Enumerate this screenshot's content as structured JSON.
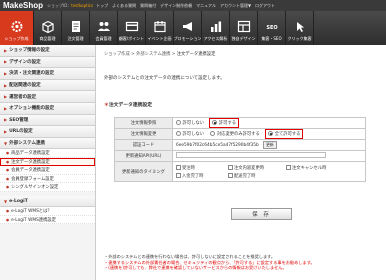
{
  "topbar": {
    "logo": "MakeShop",
    "shop_prefix": "ショップID：",
    "shop_id": "testkoptics",
    "nav": [
      "トップ",
      "よくある質問",
      "質問箱付",
      "デザイン制作依頼",
      "マニュアル",
      "アカウント管理▼",
      "ログアウト"
    ]
  },
  "toolbar": [
    {
      "label": "ショップ作成",
      "icon": "gear-icon",
      "active": true
    },
    {
      "label": "商品管理",
      "icon": "box-icon"
    },
    {
      "label": "注文管理",
      "icon": "receipt-icon"
    },
    {
      "label": "会員管理",
      "icon": "users-icon"
    },
    {
      "label": "顧客/ポイント",
      "icon": "card-icon"
    },
    {
      "label": "イベント企画",
      "icon": "calendar-icon"
    },
    {
      "label": "プロモーション",
      "icon": "megaphone-icon"
    },
    {
      "label": "アクセス解析",
      "icon": "chart-icon"
    },
    {
      "label": "独自デザイン",
      "icon": "design-icon"
    },
    {
      "label": "集客・SEO",
      "icon": "seo-icon"
    },
    {
      "label": "クリック集客",
      "icon": "click-icon"
    }
  ],
  "sidebar": {
    "sections": [
      "ショップ情報の設定",
      "デザインの設定",
      "決済・注文関連の設定",
      "配送関連の設定",
      "運営者の設定",
      "オプション機能の設定",
      "SEO管理",
      "URLの設定"
    ],
    "open_section": "外部システム連携",
    "sub_items": [
      "商品データ連携設定",
      "注文データ連携設定",
      "会員データ連携設定",
      "会員登録フォーム設定",
      "シングルサインオン設定"
    ],
    "selected_index": 1,
    "section2": "e-LogiT",
    "sub2": [
      "e-LogiT WMSとは？",
      "e-LogiT WMS連携設定"
    ]
  },
  "main": {
    "breadcrumb": [
      "ショップ作成",
      "外部システム連携",
      "注文データ連携設定"
    ],
    "intro": "外部のシステムとの注文データの連携について設定します。",
    "section_title": "注文データ連携設定",
    "rows": {
      "ref_label": "注文情報参照",
      "ref_options": [
        "許可しない",
        "許可する"
      ],
      "ref_selected": 1,
      "edit_label": "注文情報変更",
      "edit_options": [
        "許可しない",
        "対応変更のみ許可する",
        "全て許可する"
      ],
      "edit_selected": 2,
      "auth_label": "認証コード",
      "auth_code": "6ee59b7f02c64b5ce5a47f5290b4f35b",
      "copy_label": "更新",
      "url_label": "更新通知API(URL)",
      "url_value": "",
      "timing_label": "更新通知のタイミング",
      "timing_options": [
        "受注時",
        "入金完了時",
        "注文内容変更時",
        "配送完了時",
        "注文キャンセル時"
      ]
    },
    "save_label": "保 存",
    "notes": [
      "・外部のシステムとの連携を行わない場合は、許可しないに設定されることを推奨します。",
      "・連携するシステムの外部責任者の場合、セキュリティの観点から、「許可する」に設定する事をお勧めします。",
      "・(連携を)許可しても、弊社で連携を確認していないサービスからの情報はお受けいたしません。"
    ]
  }
}
